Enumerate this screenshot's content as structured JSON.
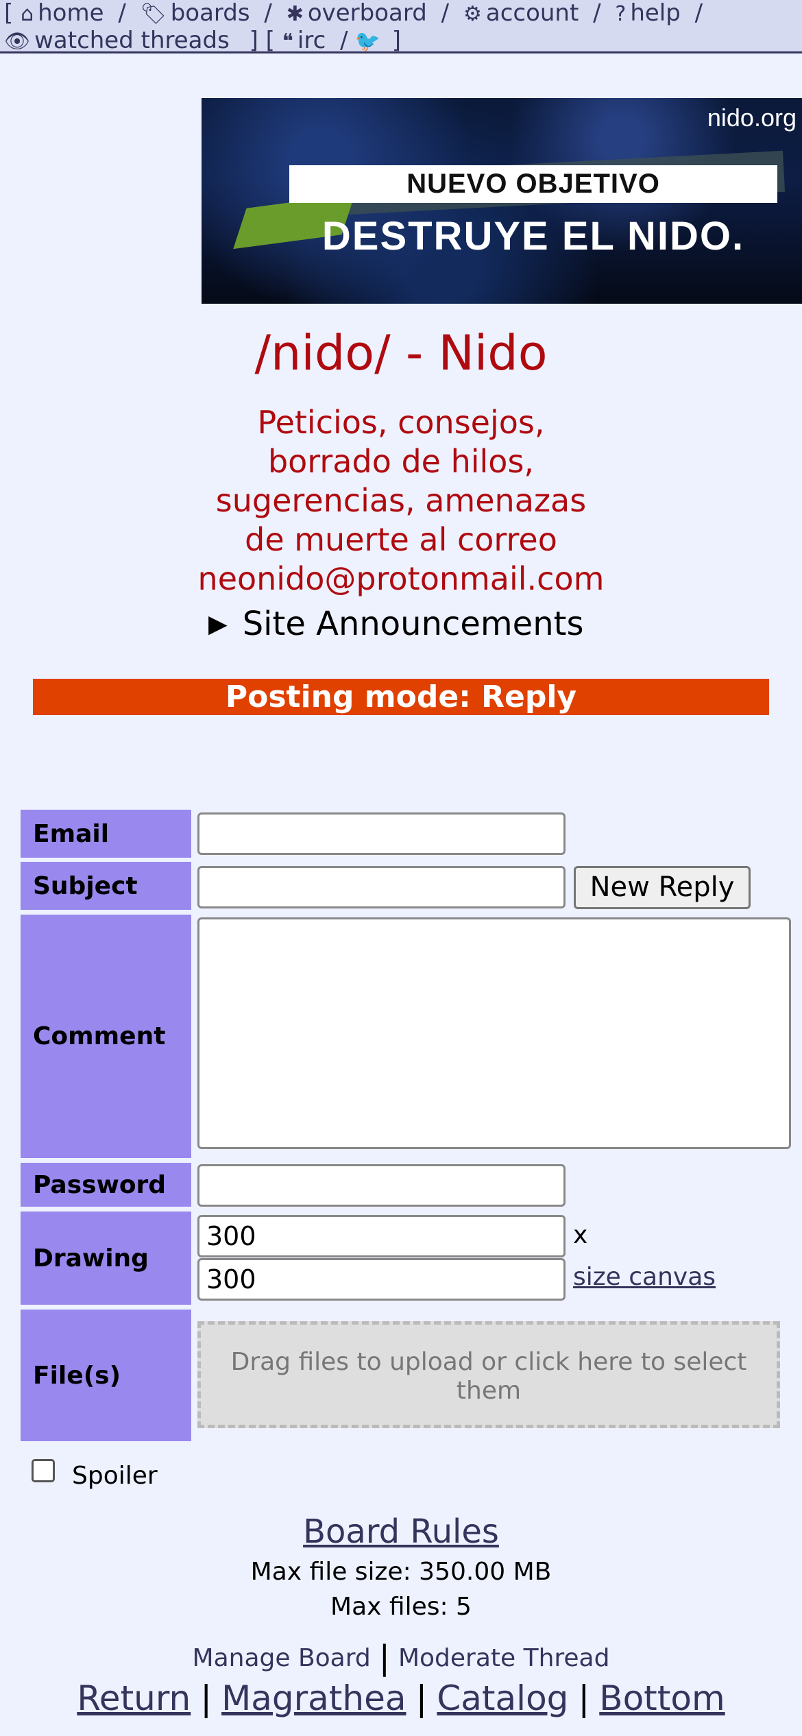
{
  "nav": {
    "row1": {
      "open": "[",
      "items": [
        {
          "icon": "home-icon",
          "glyph": "⌂",
          "label": "home"
        },
        {
          "icon": "tags-icon",
          "glyph": "🏷",
          "label": "boards"
        },
        {
          "icon": "asterisk-icon",
          "glyph": "✱",
          "label": "overboard"
        },
        {
          "icon": "gear-icon",
          "glyph": "⚙",
          "label": "account"
        },
        {
          "icon": "question-icon",
          "glyph": "?",
          "label": "help"
        }
      ],
      "sep": "/"
    },
    "row2": {
      "watched_icon": "eye-icon",
      "watched_glyph": "👁",
      "watched": "watched threads",
      "close1": "]",
      "open2": "[",
      "irc_icon": "quote-icon",
      "irc_glyph": "❝",
      "irc": "irc",
      "sep": "/",
      "twitter_icon": "twitter-icon",
      "twitter_glyph": "🐦",
      "close2": "]"
    }
  },
  "banner": {
    "site": "nido.org",
    "objective": "NUEVO OBJETIVO",
    "subtitle": "DESTRUYE EL NIDO."
  },
  "board": {
    "title": "/nido/ - Nido",
    "subtitle_lines": [
      "Peticios, consejos,",
      "borrado de hilos,",
      "sugerencias, amenazas",
      "de muerte al correo",
      "neonido@protonmail.com"
    ]
  },
  "announcements": {
    "label": "Site Announcements"
  },
  "posting_mode": "Posting mode: Reply",
  "form": {
    "email_label": "Email",
    "subject_label": "Subject",
    "comment_label": "Comment",
    "password_label": "Password",
    "drawing_label": "Drawing",
    "files_label": "File(s)",
    "new_reply": "New Reply",
    "drawing_width": "300",
    "drawing_height": "300",
    "x": "x",
    "size_canvas": "size canvas",
    "dropzone": "Drag files to upload or click here to select them",
    "spoiler": "Spoiler"
  },
  "footer": {
    "board_rules": "Board Rules",
    "max_file_size": "Max file size: 350.00 MB",
    "max_files": "Max files: 5",
    "manage_board": "Manage Board",
    "bar": "|",
    "moderate_thread": "Moderate Thread",
    "links": [
      "Return",
      "Magrathea",
      "Catalog",
      "Bottom"
    ]
  },
  "colors": {
    "label_bg": "#9988ee",
    "mode_bg": "#e04000",
    "title": "#af0a0f",
    "link": "#34345c",
    "page_bg": "#eef2fe"
  }
}
